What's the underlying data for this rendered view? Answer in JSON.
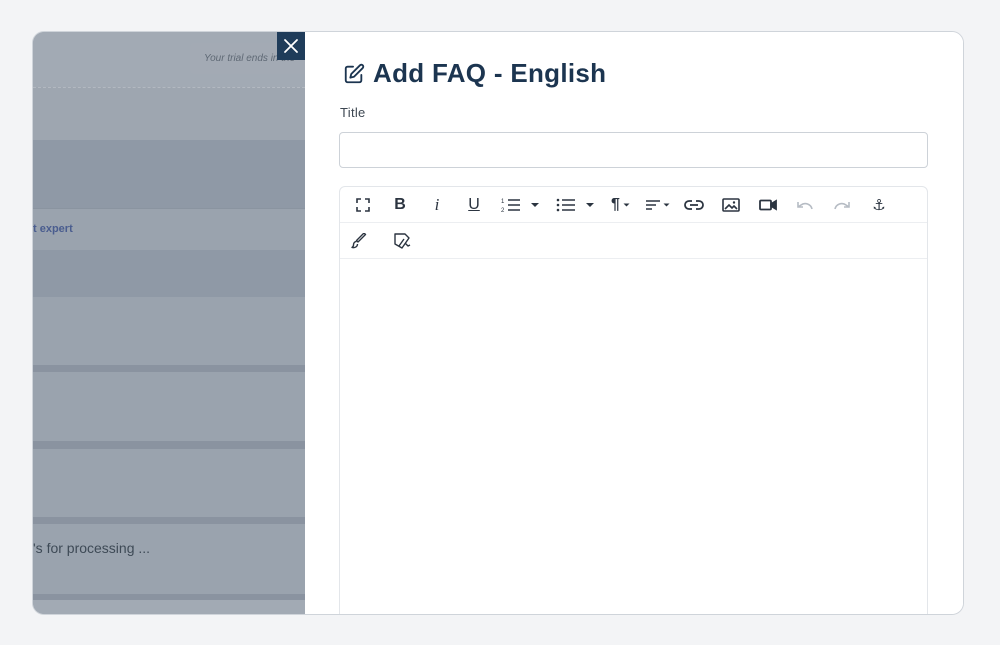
{
  "background": {
    "trial_text": "Your trial ends in the",
    "expert_link": "t expert",
    "processing_text": "'s for processing ..."
  },
  "drawer": {
    "title": "Add FAQ - English",
    "title_label": "Title",
    "title_value": "",
    "toolbar": [
      {
        "name": "fullscreen",
        "icon": "expand-icon"
      },
      {
        "name": "bold",
        "icon": "bold-icon",
        "glyph": "B"
      },
      {
        "name": "italic",
        "icon": "italic-icon",
        "glyph": "i"
      },
      {
        "name": "underline",
        "icon": "underline-icon",
        "glyph": "U"
      },
      {
        "name": "ordered-list",
        "icon": "ordered-list-icon"
      },
      {
        "name": "unordered-list",
        "icon": "unordered-list-icon"
      },
      {
        "name": "paragraph-format",
        "icon": "pilcrow-icon",
        "glyph": "¶"
      },
      {
        "name": "align",
        "icon": "align-icon"
      },
      {
        "name": "link",
        "icon": "link-icon"
      },
      {
        "name": "image",
        "icon": "image-icon"
      },
      {
        "name": "video",
        "icon": "video-icon"
      },
      {
        "name": "undo",
        "icon": "undo-icon"
      },
      {
        "name": "redo",
        "icon": "redo-icon"
      },
      {
        "name": "anchor",
        "icon": "anchor-icon",
        "glyph": "⚓"
      },
      {
        "name": "paint-format",
        "icon": "brush-icon"
      },
      {
        "name": "clear-format",
        "icon": "eraser-icon"
      }
    ]
  }
}
